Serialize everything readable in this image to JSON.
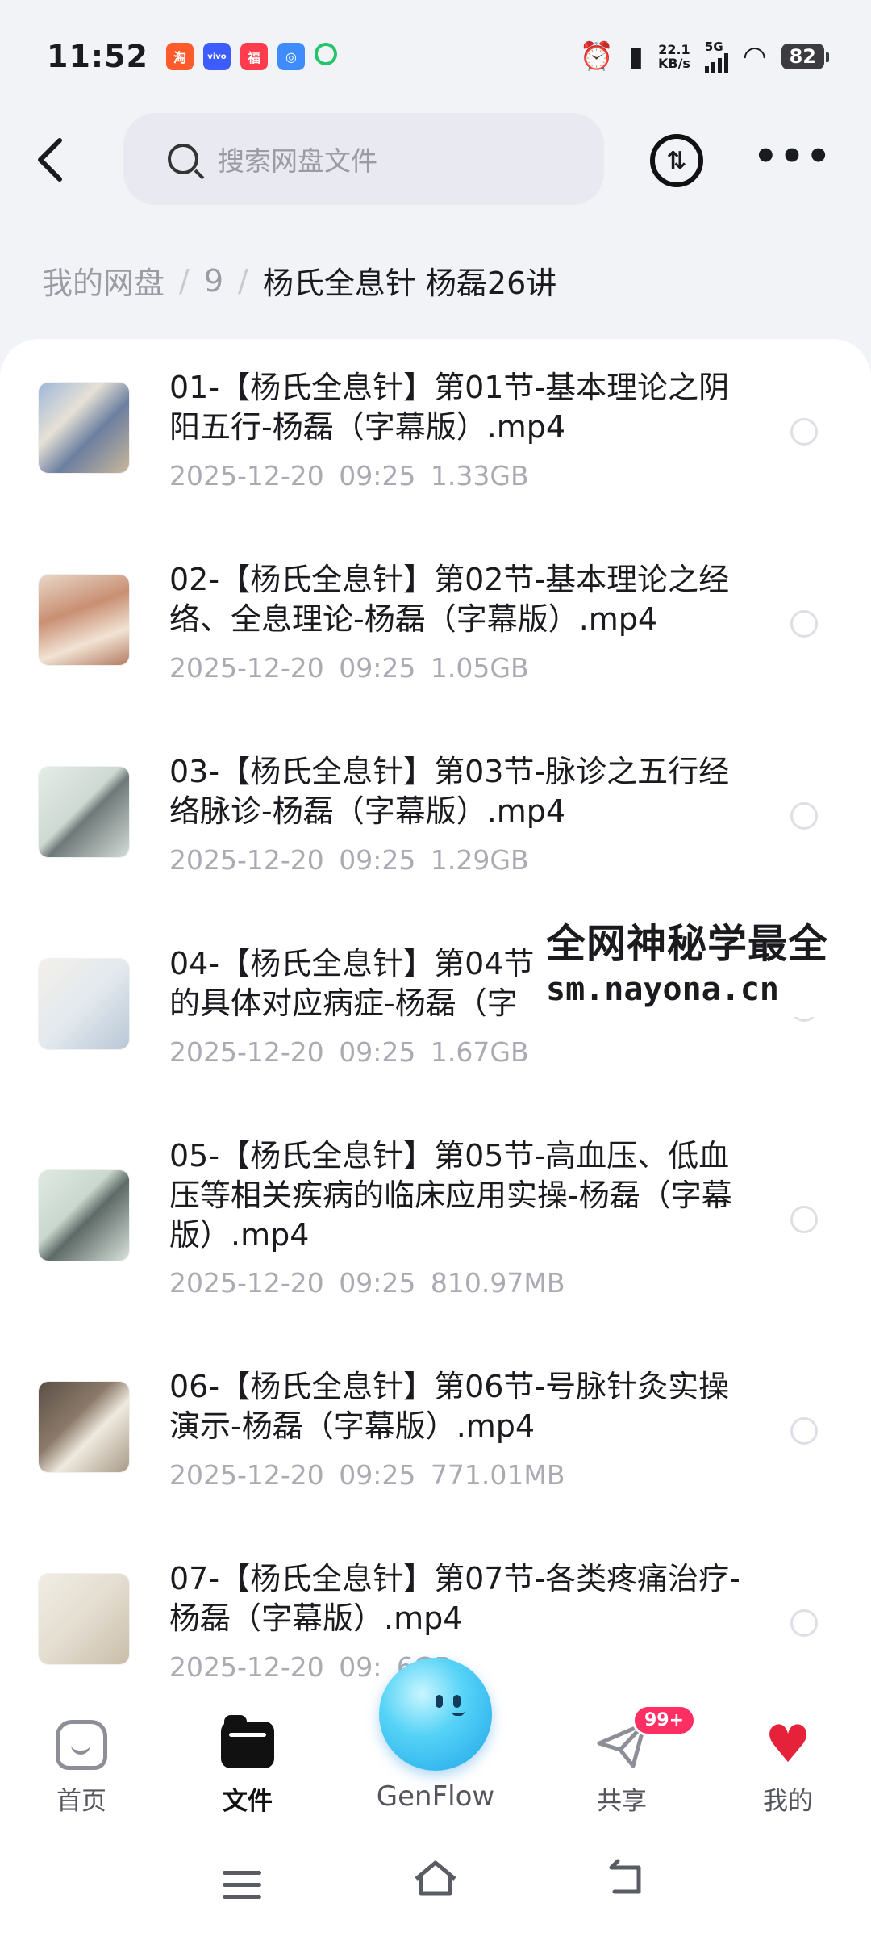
{
  "status_bar": {
    "time": "11:52",
    "net_speed_value": "22.1",
    "net_speed_unit": "KB/s",
    "network_type": "5G",
    "battery": "82"
  },
  "header": {
    "search_placeholder": "搜索网盘文件",
    "transfer_icon_text": "⇅"
  },
  "breadcrumb": {
    "root": "我的网盘",
    "separator": "/",
    "middle": "9",
    "current": "杨氏全息针 杨磊26讲"
  },
  "files": [
    {
      "name": "01-【杨氏全息针】第01节-基本理论之阴阳五行-杨磊（字幕版）.mp4",
      "date": "2025-12-20",
      "time": "09:25",
      "size": "1.33GB"
    },
    {
      "name": "02-【杨氏全息针】第02节-基本理论之经络、全息理论-杨磊（字幕版）.mp4",
      "date": "2025-12-20",
      "time": "09:25",
      "size": "1.05GB"
    },
    {
      "name": "03-【杨氏全息针】第03节-脉诊之五行经络脉诊-杨磊（字幕版）.mp4",
      "date": "2025-12-20",
      "time": "09:25",
      "size": "1.29GB"
    },
    {
      "name": "04-【杨氏全息针】第04节",
      "name_line2": "的具体对应病症-杨磊（字",
      "date": "2025-12-20",
      "time": "09:25",
      "size": "1.67GB"
    },
    {
      "name": "05-【杨氏全息针】第05节-高血压、低血压等相关疾病的临床应用实操-杨磊（字幕版）.mp4",
      "date": "2025-12-20",
      "time": "09:25",
      "size": "810.97MB"
    },
    {
      "name": "06-【杨氏全息针】第06节-号脉针灸实操演示-杨磊（字幕版）.mp4",
      "date": "2025-12-20",
      "time": "09:25",
      "size": "771.01MB"
    },
    {
      "name": "07-【杨氏全息针】第07节-各类疼痛治疗-杨磊（字幕版）.mp4",
      "date": "2025-12-20",
      "time": "09:",
      "size": "6GB"
    }
  ],
  "watermark": {
    "line1": "全网神秘学最全",
    "line2": "sm.nayona.cn"
  },
  "bottom_nav": {
    "home": "首页",
    "files": "文件",
    "genflow": "GenFlow",
    "share": "共享",
    "share_badge": "99+",
    "mine": "我的"
  },
  "colors": {
    "accent_badge": "#ff2e63",
    "orb": "#3cbdf0",
    "page_bg": "#f2f3f7"
  }
}
